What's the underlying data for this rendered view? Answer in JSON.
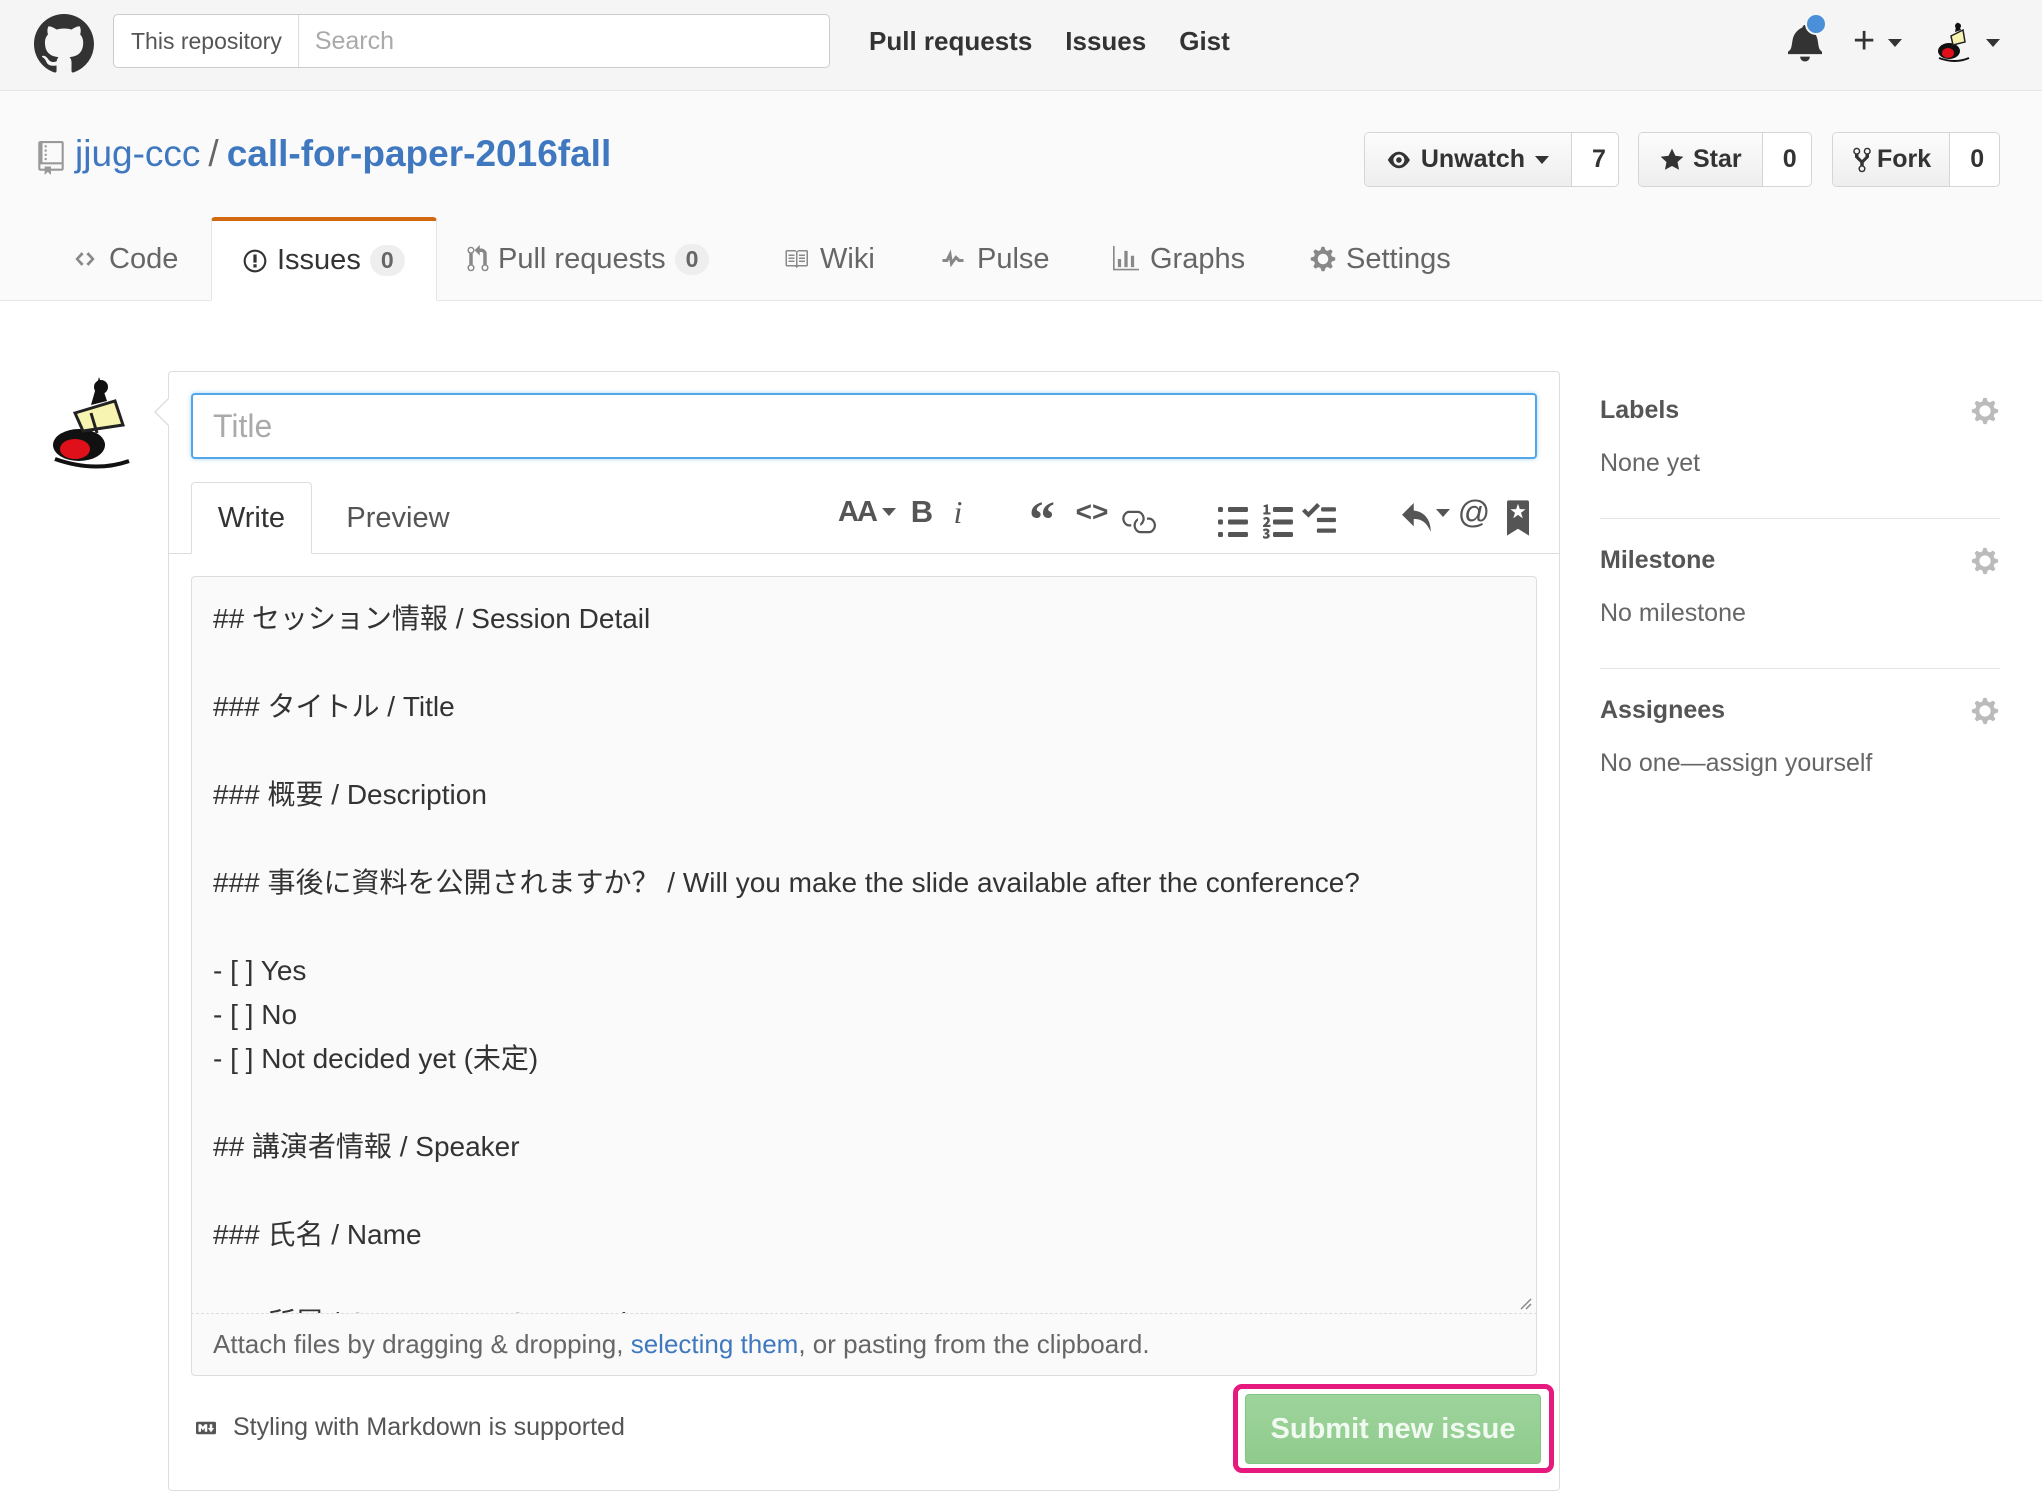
{
  "header": {
    "search_scope": "This repository",
    "search_placeholder": "Search",
    "nav": [
      "Pull requests",
      "Issues",
      "Gist"
    ]
  },
  "repo": {
    "owner": "jjug-ccc",
    "separator": "/",
    "name": "call-for-paper-2016fall",
    "watch": {
      "label": "Unwatch",
      "count": "7"
    },
    "star": {
      "label": "Star",
      "count": "0"
    },
    "fork": {
      "label": "Fork",
      "count": "0"
    }
  },
  "tabs": {
    "code": "Code",
    "issues": {
      "label": "Issues",
      "count": "0"
    },
    "pulls": {
      "label": "Pull requests",
      "count": "0"
    },
    "wiki": "Wiki",
    "pulse": "Pulse",
    "graphs": "Graphs",
    "settings": "Settings",
    "active": "Issues"
  },
  "compose": {
    "title_placeholder": "Title",
    "write_tab": "Write",
    "preview_tab": "Preview",
    "toolbar": {
      "header": "AA",
      "bold": "B",
      "italic": "i",
      "quote": "“",
      "code": "<>",
      "link": "link",
      "mention": "@"
    },
    "body": "## セッション情報 / Session Detail\n\n### タイトル / Title\n\n### 概要 / Description\n\n### 事後に資料を公開されますか？ / Will you make the slide available after the conference?\n\n- [ ] Yes\n- [ ] No\n- [ ] Not decided yet (未定)\n\n## 講演者情報 / Speaker\n\n### 氏名 / Name\n\n### 所属 / Company or Community",
    "attach_prefix": "Attach files by dragging & dropping, ",
    "attach_link": "selecting them",
    "attach_suffix": ", or pasting from the clipboard.",
    "markdown_note": "Styling with Markdown is supported",
    "submit": "Submit new issue"
  },
  "sidebar": {
    "labels": {
      "heading": "Labels",
      "value": "None yet"
    },
    "milestone": {
      "heading": "Milestone",
      "value": "No milestone"
    },
    "assignees": {
      "heading": "Assignees",
      "value": "No one—assign yourself"
    }
  },
  "colors": {
    "link": "#4078c0",
    "tab_accent": "#d26911",
    "focus_border": "#51a7e8",
    "submit_disabled": "#94cf91",
    "highlight": "#e6197f",
    "notification": "#4a90d9"
  },
  "icons": [
    "github-logo",
    "bell-icon",
    "plus-icon",
    "repo-icon",
    "eye-icon",
    "star-icon",
    "fork-icon",
    "code-icon",
    "issue-icon",
    "pull-request-icon",
    "book-icon",
    "pulse-icon",
    "graph-icon",
    "gear-icon",
    "markdown-icon"
  ]
}
